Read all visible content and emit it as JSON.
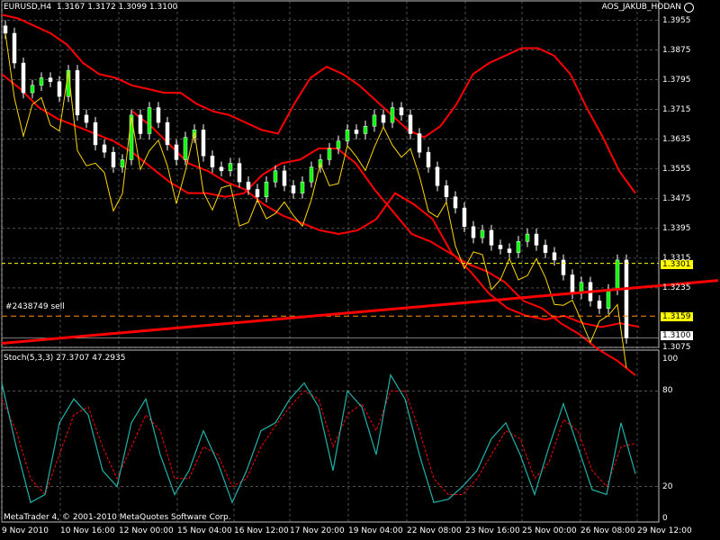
{
  "header": {
    "symbol": "EURUSD,H4",
    "ohlc": "1.3167 1.3172 1.3099 1.3100",
    "account_label": "AOS_JAKUB_HODAN",
    "stoch_label": "Stoch(5,3,3) 27.3707 47.2935",
    "footer": "MetaTrader 4, © 2001-2010 MetaQuotes Software Corp.",
    "order_label": "#2438749 sell"
  },
  "price_labels": [
    "1.3955",
    "1.3875",
    "1.3795",
    "1.3715",
    "1.3635",
    "1.3555",
    "1.3475",
    "1.3395",
    "1.3315",
    "1.3235",
    "1.3075"
  ],
  "highlighted_prices": {
    "upper_line": "1.3301",
    "order_line": "1.3159",
    "current": "1.3100"
  },
  "stoch_labels": [
    "100",
    "80",
    "20",
    "0"
  ],
  "time_labels": [
    "9 Nov 2010",
    "10 Nov 16:00",
    "12 Nov 00:00",
    "15 Nov 04:00",
    "16 Nov 12:00",
    "17 Nov 20:00",
    "19 Nov 04:00",
    "22 Nov 08:00",
    "23 Nov 16:00",
    "25 Nov 00:00",
    "26 Nov 08:00",
    "29 Nov 12:00"
  ],
  "colors": {
    "bull": "#ffffff",
    "bear": "#00ff00",
    "band": "#ff0000",
    "yellow": "#ffd700",
    "stoch_main": "#20b2aa",
    "stoch_signal": "#ff0000",
    "grid": "#808080",
    "trend": "#ff0000"
  },
  "chart_data": {
    "type": "line",
    "candles_close": [
      1.392,
      1.384,
      1.376,
      1.378,
      1.38,
      1.379,
      1.375,
      1.382,
      1.37,
      1.368,
      1.362,
      1.36,
      1.356,
      1.358,
      1.37,
      1.365,
      1.372,
      1.368,
      1.362,
      1.358,
      1.364,
      1.366,
      1.359,
      1.356,
      1.355,
      1.357,
      1.352,
      1.35,
      1.348,
      1.352,
      1.355,
      1.351,
      1.349,
      1.352,
      1.356,
      1.358,
      1.361,
      1.363,
      1.366,
      1.365,
      1.367,
      1.37,
      1.368,
      1.372,
      1.37,
      1.365,
      1.36,
      1.356,
      1.351,
      1.348,
      1.345,
      1.34,
      1.337,
      1.339,
      1.335,
      1.334,
      1.333,
      1.336,
      1.338,
      1.335,
      1.333,
      1.331,
      1.327,
      1.322,
      1.325,
      1.32,
      1.318,
      1.323,
      1.331,
      1.31
    ],
    "upper_band": [
      1.397,
      1.396,
      1.394,
      1.392,
      1.389,
      1.384,
      1.381,
      1.38,
      1.378,
      1.377,
      1.376,
      1.376,
      1.373,
      1.371,
      1.37,
      1.368,
      1.366,
      1.365,
      1.373,
      1.38,
      1.383,
      1.381,
      1.378,
      1.374,
      1.37,
      1.366,
      1.364,
      1.367,
      1.373,
      1.381,
      1.384,
      1.386,
      1.388,
      1.388,
      1.386,
      1.381,
      1.372,
      1.364,
      1.355,
      1.349
    ],
    "mid_band": [
      1.381,
      1.377,
      1.372,
      1.369,
      1.367,
      1.365,
      1.363,
      1.36,
      1.356,
      1.352,
      1.349,
      1.349,
      1.348,
      1.349,
      1.354,
      1.357,
      1.358,
      1.361,
      1.361,
      1.357,
      1.35,
      1.344,
      1.338,
      1.336,
      1.333,
      1.33,
      1.328,
      1.325,
      1.32,
      1.318,
      1.314,
      1.311,
      1.307,
      1.304,
      1.3
    ],
    "lower_band": [
      1.371,
      1.367,
      1.362,
      1.357,
      1.355,
      1.352,
      1.35,
      1.346,
      1.343,
      1.341,
      1.339,
      1.338,
      1.339,
      1.342,
      1.349,
      1.346,
      1.342,
      1.333,
      1.328,
      1.322,
      1.318,
      1.316,
      1.315,
      1.316,
      1.314,
      1.313,
      1.314,
      1.313
    ],
    "stoch_main": [
      85,
      45,
      10,
      15,
      60,
      75,
      65,
      30,
      20,
      60,
      75,
      40,
      15,
      30,
      55,
      35,
      10,
      30,
      55,
      60,
      75,
      85,
      70,
      30,
      80,
      70,
      40,
      90,
      75,
      40,
      10,
      12,
      20,
      30,
      50,
      60,
      40,
      15,
      45,
      72,
      45,
      18,
      15,
      60,
      28
    ],
    "stoch_signal": [
      75,
      55,
      25,
      15,
      40,
      65,
      70,
      45,
      25,
      45,
      65,
      55,
      25,
      25,
      45,
      40,
      20,
      25,
      45,
      58,
      70,
      80,
      75,
      45,
      65,
      72,
      55,
      80,
      80,
      55,
      25,
      15,
      15,
      25,
      40,
      55,
      50,
      25,
      35,
      62,
      55,
      30,
      20,
      45,
      47
    ],
    "ylim_price": [
      1.3075,
      1.3995
    ],
    "ylim_stoch": [
      0,
      100
    ],
    "grid": true
  }
}
